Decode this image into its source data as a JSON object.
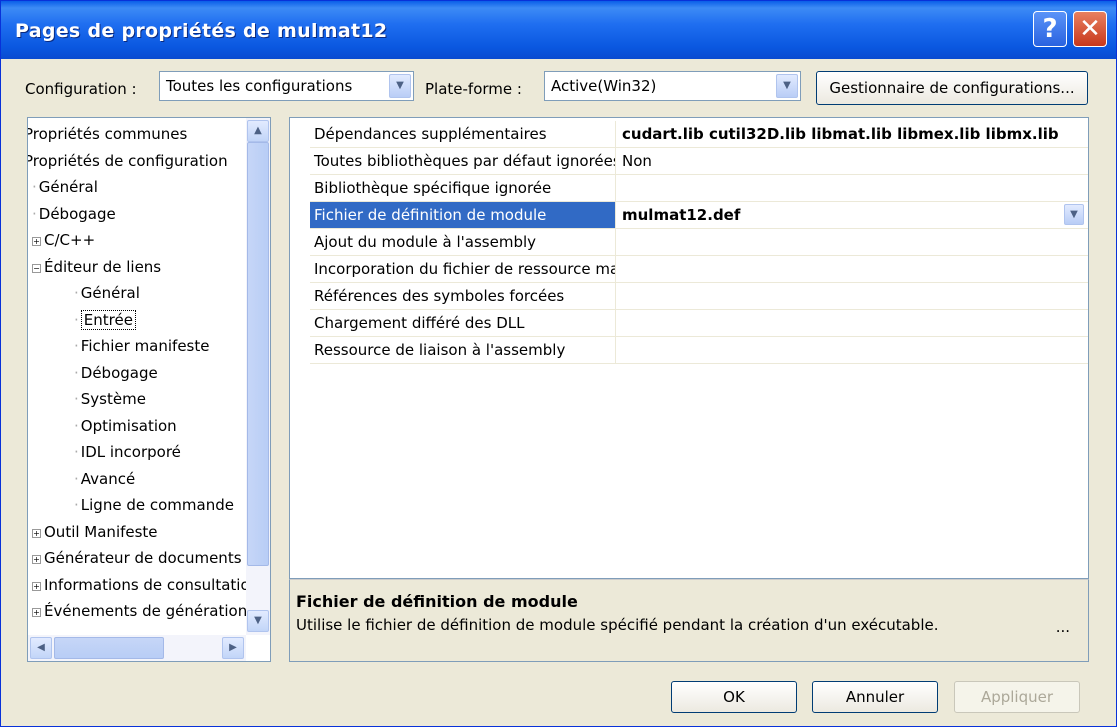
{
  "window": {
    "title": "Pages de propriétés de mulmat12"
  },
  "toolbar": {
    "configuration_label": "Configuration :",
    "configuration_value": "Toutes les configurations",
    "platform_label": "Plate-forme :",
    "platform_value": "Active(Win32)",
    "config_manager_button": "Gestionnaire de configurations..."
  },
  "tree": {
    "items": [
      {
        "label": "Propriétés communes",
        "expander": ""
      },
      {
        "label": "Propriétés de configuration",
        "expander": ""
      },
      {
        "label": "Général",
        "expander": ""
      },
      {
        "label": "Débogage",
        "expander": ""
      },
      {
        "label": "C/C++",
        "expander": "+"
      },
      {
        "label": "Éditeur de liens",
        "expander": "−"
      },
      {
        "label": "Général",
        "expander": ""
      },
      {
        "label": "Entrée",
        "expander": ""
      },
      {
        "label": "Fichier manifeste",
        "expander": ""
      },
      {
        "label": "Débogage",
        "expander": ""
      },
      {
        "label": "Système",
        "expander": ""
      },
      {
        "label": "Optimisation",
        "expander": ""
      },
      {
        "label": "IDL incorporé",
        "expander": ""
      },
      {
        "label": "Avancé",
        "expander": ""
      },
      {
        "label": "Ligne de commande",
        "expander": ""
      },
      {
        "label": "Outil Manifeste",
        "expander": "+"
      },
      {
        "label": "Générateur de documents XML",
        "expander": "+"
      },
      {
        "label": "Informations de consultation",
        "expander": "+"
      },
      {
        "label": "Événements de génération",
        "expander": "+"
      }
    ],
    "selected": "Entrée"
  },
  "properties": {
    "rows": [
      {
        "name": "Dépendances supplémentaires",
        "value": "cudart.lib cutil32D.lib libmat.lib libmex.lib libmx.lib"
      },
      {
        "name": "Toutes bibliothèques par défaut ignorées",
        "value": "Non"
      },
      {
        "name": "Bibliothèque spécifique ignorée",
        "value": ""
      },
      {
        "name": "Fichier de définition de module",
        "value": "mulmat12.def"
      },
      {
        "name": "Ajout du module à l'assembly",
        "value": ""
      },
      {
        "name": "Incorporation du fichier de ressource managée",
        "value": ""
      },
      {
        "name": "Références des symboles forcées",
        "value": ""
      },
      {
        "name": "Chargement différé des DLL",
        "value": ""
      },
      {
        "name": "Ressource de liaison à l'assembly",
        "value": ""
      }
    ],
    "selected_index": 3
  },
  "description": {
    "title": "Fichier de définition de module",
    "text": "Utilise le fichier de définition de module spécifié pendant la création d'un exécutable.",
    "more": "..."
  },
  "buttons": {
    "ok": "OK",
    "cancel": "Annuler",
    "apply": "Appliquer"
  }
}
